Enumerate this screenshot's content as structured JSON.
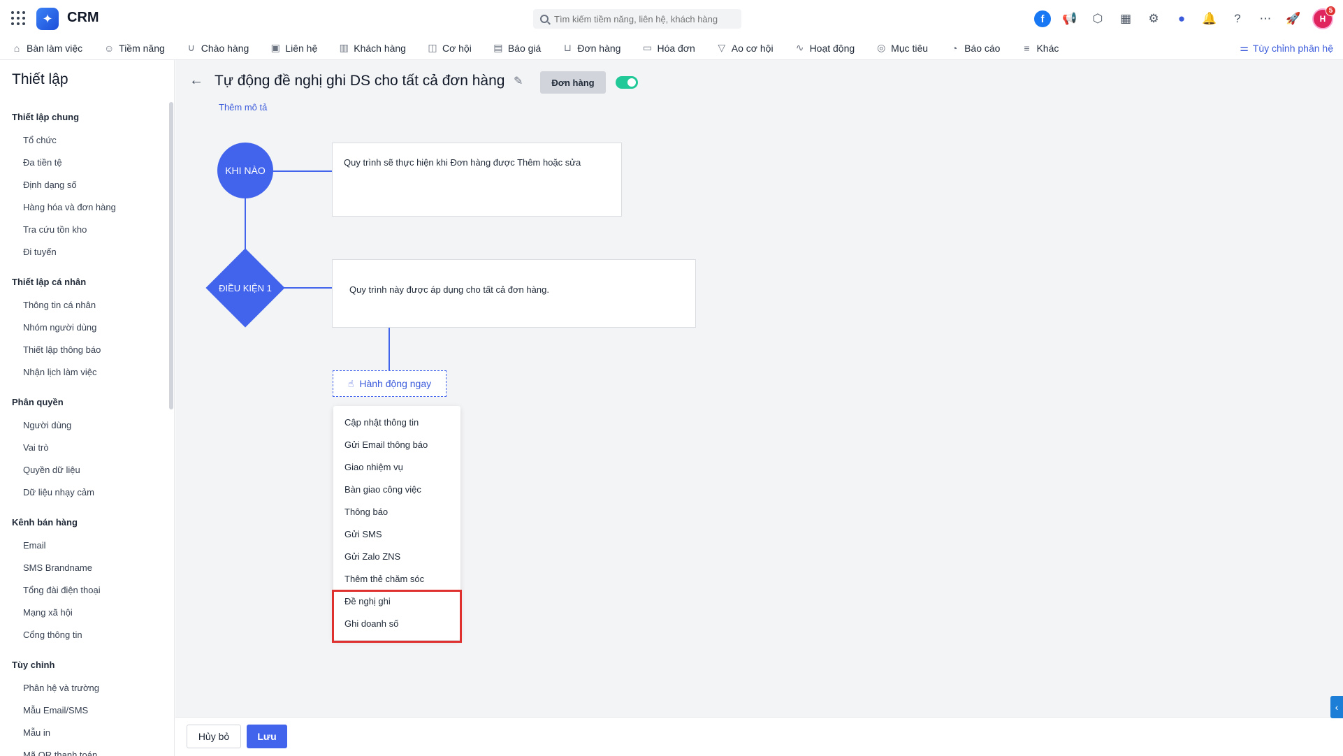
{
  "app": {
    "brand": "CRM"
  },
  "search": {
    "placeholder": "Tìm kiếm tiềm năng, liên hệ, khách hàng"
  },
  "user": {
    "initials": "H",
    "notification_count": "5"
  },
  "nav": {
    "items": [
      {
        "label": "Bàn làm việc",
        "icon": "home-icon"
      },
      {
        "label": "Tiềm năng",
        "icon": "user-circle-icon"
      },
      {
        "label": "Chào hàng",
        "icon": "magnet-icon"
      },
      {
        "label": "Liên hệ",
        "icon": "contact-icon"
      },
      {
        "label": "Khách hàng",
        "icon": "building-icon"
      },
      {
        "label": "Cơ hội",
        "icon": "briefcase-icon"
      },
      {
        "label": "Báo giá",
        "icon": "quote-icon"
      },
      {
        "label": "Đơn hàng",
        "icon": "cart-icon"
      },
      {
        "label": "Hóa đơn",
        "icon": "invoice-icon"
      },
      {
        "label": "Ao cơ hội",
        "icon": "funnel-icon"
      },
      {
        "label": "Hoạt động",
        "icon": "activity-icon"
      },
      {
        "label": "Mục tiêu",
        "icon": "target-icon"
      },
      {
        "label": "Báo cáo",
        "icon": "pie-chart-icon"
      },
      {
        "label": "Khác",
        "icon": "menu-icon"
      }
    ],
    "customize_label": "Tùy chỉnh phân hệ"
  },
  "sidebar": {
    "title": "Thiết lập",
    "sections": [
      {
        "title": "Thiết lập chung",
        "items": [
          "Tổ chức",
          "Đa tiền tệ",
          "Định dạng số",
          "Hàng hóa và đơn hàng",
          "Tra cứu tồn kho",
          "Đi tuyến"
        ]
      },
      {
        "title": "Thiết lập cá nhân",
        "items": [
          "Thông tin cá nhân",
          "Nhóm người dùng",
          "Thiết lập thông báo",
          "Nhận lịch làm việc"
        ]
      },
      {
        "title": "Phân quyền",
        "items": [
          "Người dùng",
          "Vai trò",
          "Quyền dữ liệu",
          "Dữ liệu nhạy cảm"
        ]
      },
      {
        "title": "Kênh bán hàng",
        "items": [
          "Email",
          "SMS Brandname",
          "Tổng đài điện thoại",
          "Mạng xã hội",
          "Cổng thông tin"
        ]
      },
      {
        "title": "Tùy chỉnh",
        "items": [
          "Phân hệ và trường",
          "Mẫu Email/SMS",
          "Mẫu in",
          "Mã QR thanh toán"
        ]
      }
    ]
  },
  "workflow": {
    "title": "Tự động đề nghị ghi DS cho tất cả đơn hàng",
    "tag": "Đơn hàng",
    "enabled": true,
    "add_description": "Thêm mô tả",
    "when_node": "KHI NÀO",
    "when_text_prefix": "Quy trình sẽ thực hiện khi ",
    "when_text_bold": "Đơn hàng được Thêm hoặc sửa",
    "condition_node": "ĐIỀU KIỆN 1",
    "condition_text": "Quy trình này được áp dụng cho tất cả đơn hàng.",
    "action_button": "Hành động ngay",
    "action_menu": [
      "Cập nhật thông tin",
      "Gửi Email thông báo",
      "Giao nhiệm vụ",
      "Bàn giao công việc",
      "Thông báo",
      "Gửi SMS",
      "Gửi Zalo ZNS",
      "Thêm thẻ chăm sóc",
      "Đề nghị ghi",
      "Ghi doanh số"
    ]
  },
  "footer": {
    "cancel": "Hủy bỏ",
    "save": "Lưu"
  }
}
